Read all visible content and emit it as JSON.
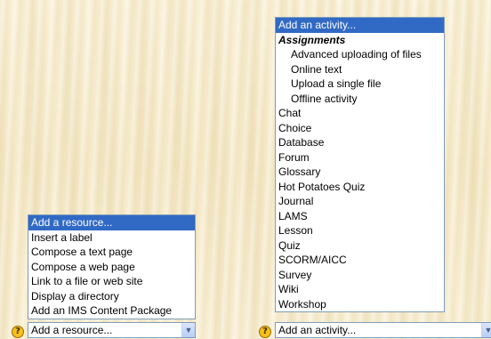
{
  "resource": {
    "help_icon": "?",
    "selected": "Add a resource...",
    "options": [
      "Add a resource...",
      "Insert a label",
      "Compose a text page",
      "Compose a web page",
      "Link to a file or web site",
      "Display a directory",
      "Add an IMS Content Package"
    ]
  },
  "activity": {
    "help_icon": "?",
    "selected": "Add an activity...",
    "first_option": "Add an activity...",
    "group_label": "Assignments",
    "group_options": [
      "Advanced uploading of files",
      "Online text",
      "Upload a single file",
      "Offline activity"
    ],
    "options": [
      "Chat",
      "Choice",
      "Database",
      "Forum",
      "Glossary",
      "Hot Potatoes Quiz",
      "Journal",
      "LAMS",
      "Lesson",
      "Quiz",
      "SCORM/AICC",
      "Survey",
      "Wiki",
      "Workshop"
    ]
  },
  "colors": {
    "highlight": "#316ac5",
    "border": "#7f9db9",
    "help_icon": "#f7c01a"
  }
}
